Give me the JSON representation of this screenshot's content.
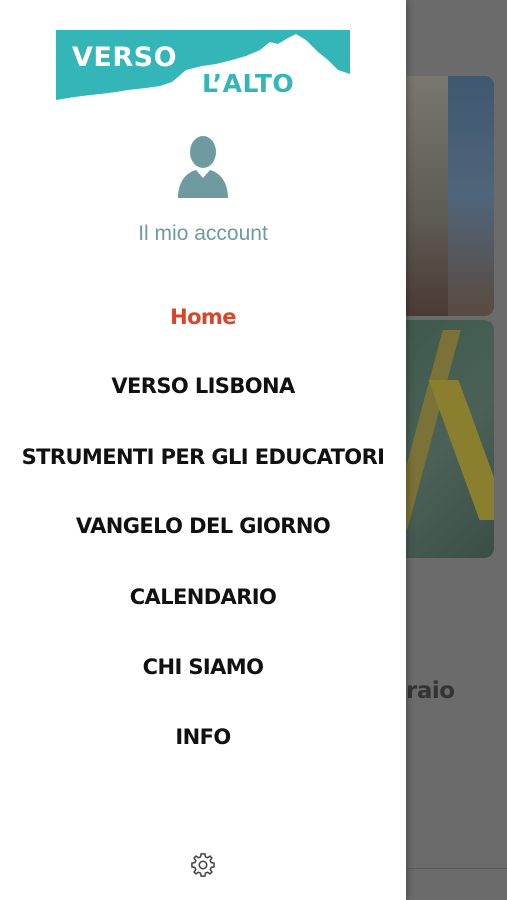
{
  "logo": {
    "line1": "VERSO",
    "line2": "L’ALTO",
    "colors": {
      "teal": "#34b6b8",
      "white": "#ffffff"
    }
  },
  "account": {
    "icon": "user-avatar-icon",
    "label": "Il mio account"
  },
  "menu": {
    "items": [
      {
        "label": "Home",
        "active": true
      },
      {
        "label": "VERSO LISBONA",
        "active": false
      },
      {
        "label": "STRUMENTI PER GLI EDUCATORI",
        "active": false
      },
      {
        "label": "VANGELO DEL GIORNO",
        "active": false
      },
      {
        "label": "CALENDARIO",
        "active": false
      },
      {
        "label": "CHI SIAMO",
        "active": false
      },
      {
        "label": "INFO",
        "active": false
      }
    ],
    "active_color": "#d9452b",
    "text_color": "#111111"
  },
  "footer": {
    "settings_icon": "gear-icon"
  },
  "background": {
    "caption_fragment": "raio"
  }
}
